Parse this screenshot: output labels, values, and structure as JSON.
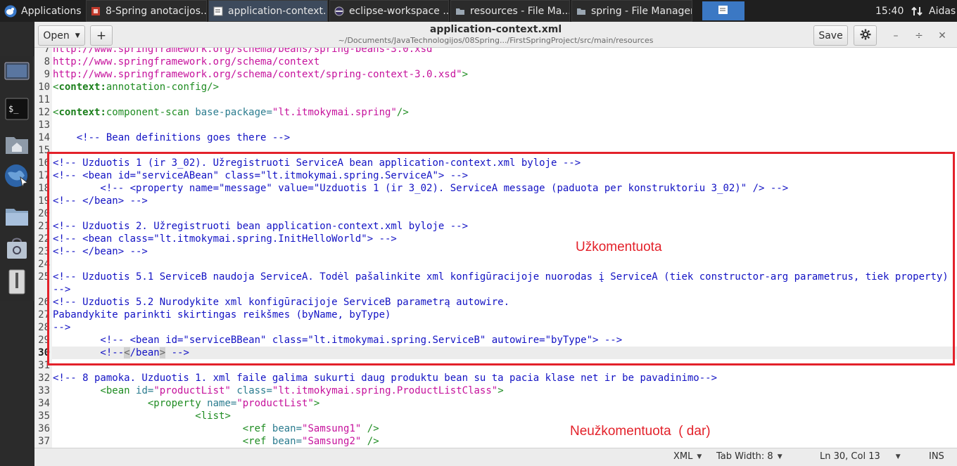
{
  "top_panel": {
    "applications_label": "Applications",
    "tasks": [
      {
        "label": "8-Spring anotacijos...",
        "icon": "document-red-icon",
        "active": false
      },
      {
        "label": "application-context...",
        "icon": "text-editor-icon",
        "active": true
      },
      {
        "label": "eclipse-workspace ...",
        "icon": "eclipse-icon",
        "active": false
      },
      {
        "label": "resources - File Ma...",
        "icon": "folder-icon",
        "active": false
      },
      {
        "label": "spring - File Manager",
        "icon": "folder-icon",
        "active": false
      }
    ],
    "clock": "15:40",
    "user": "Aidas"
  },
  "window": {
    "open_label": "Open",
    "new_tab_label": "+",
    "title": "application-context.xml",
    "subtitle": "~/Documents/JavaTechnologijos/08Spring.../FirstSpringProject/src/main/resources",
    "save_label": "Save",
    "minimize_glyph": "–",
    "maximize_glyph": "÷",
    "close_glyph": "✕"
  },
  "editor": {
    "current_line": 30,
    "lines": [
      {
        "num": "7",
        "tokens": [
          {
            "c": "s",
            "t": "http://www.springframework.org/schema/beans/spring-beans-3.0.xsd"
          }
        ]
      },
      {
        "num": "8",
        "tokens": [
          {
            "c": "s",
            "t": "http://www.springframework.org/schema/context"
          }
        ]
      },
      {
        "num": "9",
        "tokens": [
          {
            "c": "s",
            "t": "http://www.springframework.org/schema/context/spring-context-3.0.xsd\""
          },
          {
            "c": "p",
            "t": ">"
          }
        ]
      },
      {
        "num": "10",
        "tokens": [
          {
            "c": "p",
            "t": "<"
          },
          {
            "c": "n",
            "t": "context:"
          },
          {
            "c": "g",
            "t": "annotation-config"
          },
          {
            "c": "p",
            "t": "/>"
          }
        ]
      },
      {
        "num": "11",
        "tokens": []
      },
      {
        "num": "12",
        "tokens": [
          {
            "c": "p",
            "t": "<"
          },
          {
            "c": "n",
            "t": "context:"
          },
          {
            "c": "g",
            "t": "component-scan"
          },
          {
            "c": "x",
            "t": " "
          },
          {
            "c": "a",
            "t": "base-package="
          },
          {
            "c": "s",
            "t": "\"lt.itmokymai.spring\""
          },
          {
            "c": "p",
            "t": "/>"
          }
        ]
      },
      {
        "num": "13",
        "tokens": []
      },
      {
        "num": "14",
        "tokens": [
          {
            "c": "m",
            "t": "    <!-- Bean definitions goes there -->"
          }
        ]
      },
      {
        "num": "15",
        "tokens": []
      },
      {
        "num": "16",
        "tokens": [
          {
            "c": "m",
            "t": "<!-- Uzduotis 1 (ir 3_02). Užregistruoti ServiceA bean application-context.xml byloje -->"
          }
        ]
      },
      {
        "num": "17",
        "tokens": [
          {
            "c": "m",
            "t": "<!-- <bean id=\"serviceABean\" class=\"lt.itmokymai.spring.ServiceA\"> -->"
          }
        ]
      },
      {
        "num": "18",
        "tokens": [
          {
            "c": "m",
            "t": "        <!-- <property name=\"message\" value=\"Uzduotis 1 (ir 3_02). ServiceA message (paduota per konstruktoriu 3_02)\" /> -->"
          }
        ]
      },
      {
        "num": "19",
        "tokens": [
          {
            "c": "m",
            "t": "<!-- </bean> -->"
          }
        ]
      },
      {
        "num": "20",
        "tokens": []
      },
      {
        "num": "21",
        "tokens": [
          {
            "c": "m",
            "t": "<!-- Uzduotis 2. Užregistruoti bean application-context.xml byloje -->"
          }
        ]
      },
      {
        "num": "22",
        "tokens": [
          {
            "c": "m",
            "t": "<!-- <bean class=\"lt.itmokymai.spring.InitHelloWorld\"> -->"
          }
        ]
      },
      {
        "num": "23",
        "tokens": [
          {
            "c": "m",
            "t": "<!-- </bean> -->"
          }
        ]
      },
      {
        "num": "24",
        "tokens": []
      },
      {
        "num": "25",
        "tokens": [
          {
            "c": "m",
            "t": "<!-- Uzduotis 5.1 ServiceB naudoja ServiceA. Todėl pašalinkite xml konfigūracijoje nuorodas į ServiceA (tiek constructor-arg parametrus, tiek property) -->"
          }
        ]
      },
      {
        "num": "26",
        "tokens": [
          {
            "c": "m",
            "t": "<!-- Uzduotis 5.2 Nurodykite xml konfigūracijoje ServiceB parametrą autowire."
          }
        ]
      },
      {
        "num": "27",
        "tokens": [
          {
            "c": "m",
            "t": "Pabandykite parinkti skirtingas reikšmes (byName, byType)"
          }
        ]
      },
      {
        "num": "28",
        "tokens": [
          {
            "c": "m",
            "t": "-->"
          }
        ]
      },
      {
        "num": "29",
        "tokens": [
          {
            "c": "m",
            "t": "        <!-- <bean id=\"serviceBBean\" class=\"lt.itmokymai.spring.ServiceB\" autowire=\"byType\"> -->"
          }
        ]
      },
      {
        "num": "30",
        "tokens": [
          {
            "c": "m",
            "t": "        <!--"
          },
          {
            "c": "b",
            "t": "<"
          },
          {
            "c": "m",
            "t": "/bean"
          },
          {
            "c": "b",
            "t": ">"
          },
          {
            "c": "m",
            "t": " -->"
          }
        ]
      },
      {
        "num": "31",
        "tokens": []
      },
      {
        "num": "32",
        "tokens": [
          {
            "c": "m",
            "t": "<!-- 8 pamoka. Uzduotis 1. xml faile galima sukurti daug produktu bean su ta pacia klase net ir be pavadinimo-->"
          }
        ]
      },
      {
        "num": "33",
        "tokens": [
          {
            "c": "x",
            "t": "        "
          },
          {
            "c": "p",
            "t": "<"
          },
          {
            "c": "g",
            "t": "bean"
          },
          {
            "c": "x",
            "t": " "
          },
          {
            "c": "a",
            "t": "id="
          },
          {
            "c": "s",
            "t": "\"productList\""
          },
          {
            "c": "x",
            "t": " "
          },
          {
            "c": "a",
            "t": "class="
          },
          {
            "c": "s",
            "t": "\"lt.itmokymai.spring.ProductListClass\""
          },
          {
            "c": "p",
            "t": ">"
          }
        ]
      },
      {
        "num": "34",
        "tokens": [
          {
            "c": "x",
            "t": "                "
          },
          {
            "c": "p",
            "t": "<"
          },
          {
            "c": "g",
            "t": "property"
          },
          {
            "c": "x",
            "t": " "
          },
          {
            "c": "a",
            "t": "name="
          },
          {
            "c": "s",
            "t": "\"productList\""
          },
          {
            "c": "p",
            "t": ">"
          }
        ]
      },
      {
        "num": "35",
        "tokens": [
          {
            "c": "x",
            "t": "                        "
          },
          {
            "c": "p",
            "t": "<"
          },
          {
            "c": "g",
            "t": "list"
          },
          {
            "c": "p",
            "t": ">"
          }
        ]
      },
      {
        "num": "36",
        "tokens": [
          {
            "c": "x",
            "t": "                                "
          },
          {
            "c": "p",
            "t": "<"
          },
          {
            "c": "g",
            "t": "ref"
          },
          {
            "c": "x",
            "t": " "
          },
          {
            "c": "a",
            "t": "bean="
          },
          {
            "c": "s",
            "t": "\"Samsung1\""
          },
          {
            "c": "x",
            "t": " "
          },
          {
            "c": "p",
            "t": "/>"
          }
        ]
      },
      {
        "num": "37",
        "tokens": [
          {
            "c": "x",
            "t": "                                "
          },
          {
            "c": "p",
            "t": "<"
          },
          {
            "c": "g",
            "t": "ref"
          },
          {
            "c": "x",
            "t": " "
          },
          {
            "c": "a",
            "t": "bean="
          },
          {
            "c": "s",
            "t": "\"Samsung2\""
          },
          {
            "c": "x",
            "t": " "
          },
          {
            "c": "p",
            "t": "/>"
          }
        ]
      }
    ]
  },
  "annotations": {
    "commented": "Užkomentuota",
    "not_commented": "Neužkomentuota  ( dar)"
  },
  "statusbar": {
    "language": "XML",
    "tab_width": "Tab Width: 8",
    "position": "Ln 30, Col 13",
    "mode": "INS"
  },
  "colors": {
    "annotation_red": "#e3212a",
    "comment_blue": "#1212c4",
    "string_magenta": "#c6129c",
    "tag_green": "#1f8c22"
  }
}
